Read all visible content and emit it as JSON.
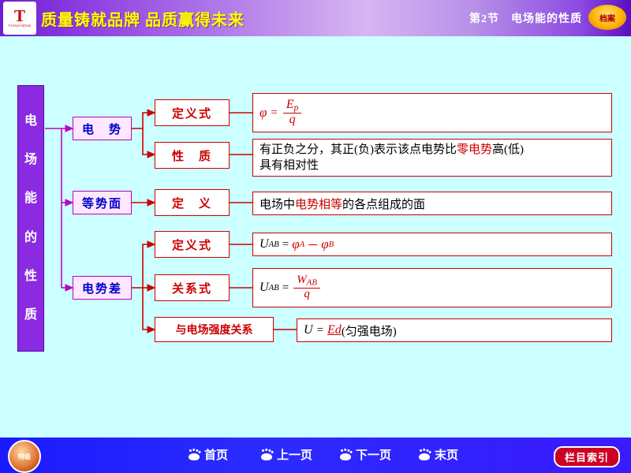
{
  "header": {
    "logo_mark": "T",
    "logo_sub": "TIANCHENG",
    "slogan": "质量铸就品牌 品质赢得未来",
    "section": "第2节　电场能的性质",
    "badge": "档案"
  },
  "vertical_title": "电场能的性质",
  "branches": {
    "dianshi": {
      "label": "电　势",
      "children": [
        {
          "label": "定义式",
          "content_type": "formula_phi"
        },
        {
          "label": "性　质",
          "content_type": "text2",
          "line1_a": "有正负之分，其正(负)表示该点电势比",
          "line1_b": "零电势",
          "line1_c": "高(低)",
          "line2": "具有相对性"
        }
      ]
    },
    "dengshimian": {
      "label": "等势面",
      "children": [
        {
          "label": "定　义",
          "content_type": "text1",
          "text_a": "电场中",
          "text_b": "电势相等",
          "text_c": "的各点组成的面"
        }
      ]
    },
    "dianshicha": {
      "label": "电势差",
      "children": [
        {
          "label": "定义式",
          "content_type": "formula_uab_phi"
        },
        {
          "label": "关系式",
          "content_type": "formula_uab_w"
        },
        {
          "label": "与电场强度关系",
          "content_type": "formula_ed"
        }
      ]
    }
  },
  "formulas": {
    "phi": {
      "lhs": "φ",
      "eq": "=",
      "num": "E",
      "num_sub": "p",
      "den": "q"
    },
    "uab_phi": {
      "lhs": "U",
      "lhs_sub": "AB",
      "eq": "=",
      "rhs_a": "φ",
      "rhs_a_sub": "A",
      "minus": "－",
      "rhs_b": "φ",
      "rhs_b_sub": "B"
    },
    "uab_w": {
      "lhs": "U",
      "lhs_sub": "AB",
      "eq": "=",
      "num": "W",
      "num_sub": "AB",
      "den": "q"
    },
    "ed": {
      "lhs": "U",
      "eq": "=",
      "rhs": "Ed",
      "note": "(匀强电场)"
    }
  },
  "footer": {
    "logo_text": "特级",
    "nav": [
      {
        "label": "首页",
        "icon": "paw-icon"
      },
      {
        "label": "上一页",
        "icon": "paw-icon"
      },
      {
        "label": "下一页",
        "icon": "paw-icon"
      },
      {
        "label": "末页",
        "icon": "paw-icon"
      }
    ],
    "index_button": "栏目索引"
  },
  "colors": {
    "page_bg": "#CCFFFF",
    "accent_purple": "#8A2BE2",
    "accent_red": "#CC0000",
    "accent_blue": "#0000CC",
    "footer_blue": "#1A1AFF"
  }
}
